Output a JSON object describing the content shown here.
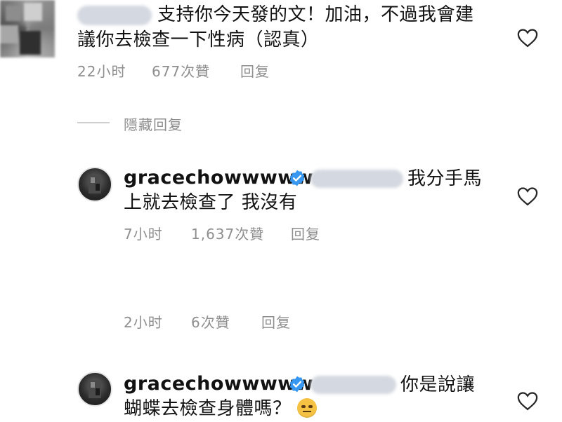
{
  "comments": [
    {
      "line1": "支持你今天發的文！加油，不過我會建",
      "line2": "議你去檢查一下性病（認真）",
      "time": "22小时",
      "likes": "677次贊",
      "reply_label": "回复"
    }
  ],
  "hide_replies_label": "隱藏回复",
  "replies": [
    {
      "username": "gracechowwwww",
      "text_a": "我分手馬",
      "text_b": "上就去檢查了 我沒有",
      "time": "7小时",
      "likes": "1,637次贊",
      "reply_label": "回复"
    },
    {
      "time": "2小时",
      "likes": "6次贊",
      "reply_label": "回复"
    },
    {
      "username": "gracechowwwww",
      "text_a": "你是說讓",
      "text_b": "蝴蝶去檢查身體嗎？",
      "emoji": "rolling-eyes-emoji"
    }
  ],
  "icons": {
    "heart": "heart-outline-icon",
    "verified": "verified-badge-icon"
  },
  "colors": {
    "text": "#121212",
    "meta": "#8e8e8e",
    "verified": "#3897f0",
    "divider": "#cfcfcf"
  }
}
